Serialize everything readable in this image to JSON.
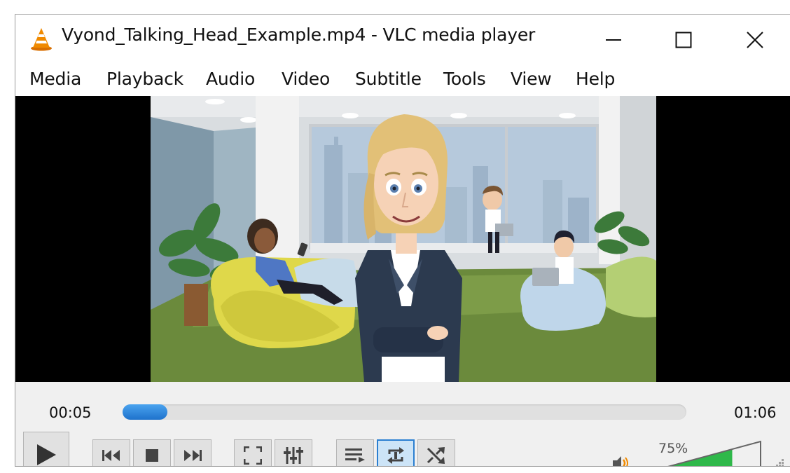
{
  "window": {
    "title": "Vyond_Talking_Head_Example.mp4 - VLC media player",
    "app_icon": "vlc-cone-icon",
    "buttons": [
      "minimize-icon",
      "maximize-icon",
      "close-icon"
    ]
  },
  "menu": {
    "items": [
      "Media",
      "Playback",
      "Audio",
      "Video",
      "Subtitle",
      "Tools",
      "View",
      "Help"
    ]
  },
  "playback": {
    "elapsed": "00:05",
    "total": "01:06",
    "progress": 0.08,
    "volume_label": "75%",
    "volume": 0.75
  },
  "controls": {
    "icons": [
      "play-icon",
      "previous-icon",
      "stop-icon",
      "next-icon",
      "fullscreen-icon",
      "extended-settings-icon",
      "playlist-icon",
      "loop-icon",
      "shuffle-icon",
      "speaker-icon"
    ]
  },
  "colors": {
    "accent": "#1e72cc",
    "active_button": "#cce4f7",
    "volume_fill": "#2fb84a",
    "vlc_orange": "#f08a00"
  }
}
